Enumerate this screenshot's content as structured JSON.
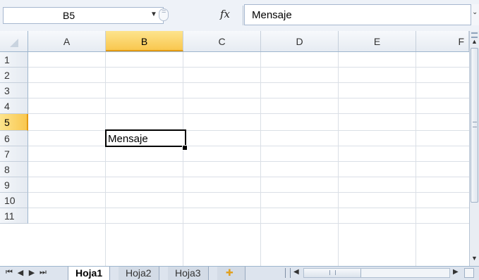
{
  "formula_bar": {
    "name_box_value": "B5",
    "fx_label": "fx",
    "formula_value": "Mensaje"
  },
  "columns": [
    "A",
    "B",
    "C",
    "D",
    "E",
    "F"
  ],
  "rows": [
    "1",
    "2",
    "3",
    "4",
    "5",
    "6",
    "7",
    "8",
    "9",
    "10",
    "11"
  ],
  "selection": {
    "column": "B",
    "row": "5",
    "cell_value": "Mensaje"
  },
  "sheet_tabs": {
    "tabs": [
      "Hoja1",
      "Hoja2",
      "Hoja3"
    ],
    "active": "Hoja1"
  },
  "colors": {
    "selected_header": "#f9c74f",
    "header_bg": "#e6ebf2",
    "gridline": "#dadfe6"
  }
}
